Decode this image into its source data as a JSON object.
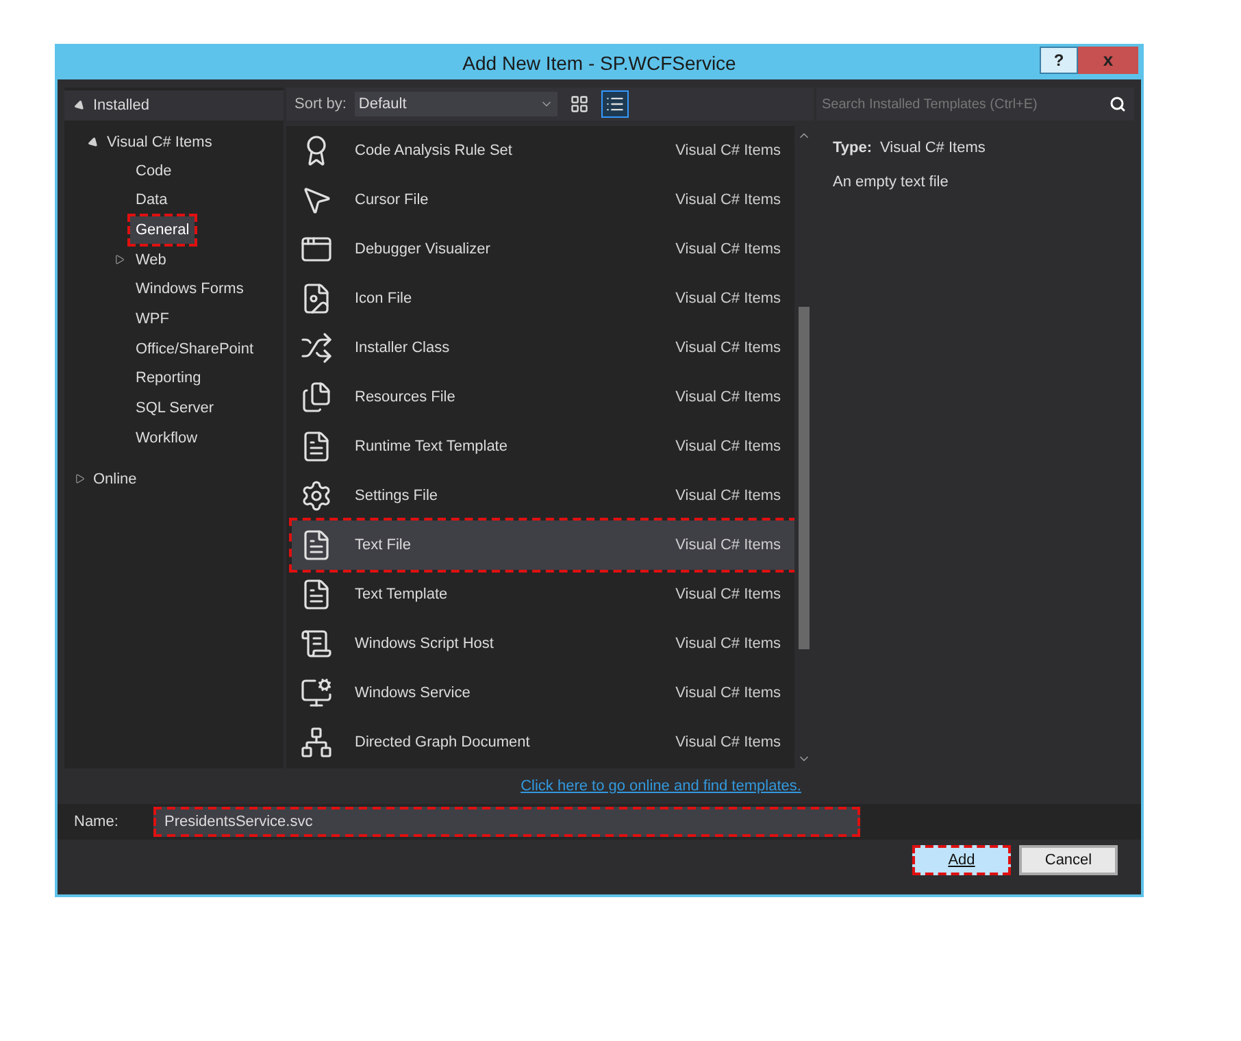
{
  "window": {
    "title": "Add New Item - SP.WCFService",
    "buttons": [
      "?",
      "x"
    ]
  },
  "tree": [
    {
      "label": "Installed",
      "expanded": true,
      "children": [
        {
          "label": "Visual C# Items",
          "expanded": true,
          "children": [
            {
              "label": "Code",
              "selected": false,
              "highlighted": false
            },
            {
              "label": "Data",
              "selected": false,
              "highlighted": false
            },
            {
              "label": "General",
              "selected": true,
              "highlighted": true
            },
            {
              "label": "Web",
              "selected": false,
              "highlighted": false,
              "expanded": false
            },
            {
              "label": "Windows Forms",
              "selected": false,
              "highlighted": false
            },
            {
              "label": "WPF",
              "selected": false,
              "highlighted": false
            },
            {
              "label": "Office/SharePoint",
              "selected": false,
              "highlighted": false
            },
            {
              "label": "Reporting",
              "selected": false,
              "highlighted": false
            },
            {
              "label": "SQL Server",
              "selected": false,
              "highlighted": false
            },
            {
              "label": "Workflow",
              "selected": false,
              "highlighted": false
            }
          ]
        }
      ]
    },
    {
      "label": "Online",
      "expanded": false
    }
  ],
  "toolbar": {
    "sort_label": "Sort by:",
    "sort_value": "Default",
    "view_modes": [
      {
        "kind": "grid",
        "selected": false
      },
      {
        "kind": "list",
        "selected": true
      }
    ]
  },
  "search": {
    "placeholder": "Search Installed Templates (Ctrl+E)"
  },
  "templates": [
    {
      "name": "Code Analysis Rule Set",
      "category": "Visual C# Items",
      "selected": false,
      "highlighted": false
    },
    {
      "name": "Cursor File",
      "category": "Visual C# Items",
      "selected": false,
      "highlighted": false
    },
    {
      "name": "Debugger Visualizer",
      "category": "Visual C# Items",
      "selected": false,
      "highlighted": false
    },
    {
      "name": "Icon File",
      "category": "Visual C# Items",
      "selected": false,
      "highlighted": false
    },
    {
      "name": "Installer Class",
      "category": "Visual C# Items",
      "selected": false,
      "highlighted": false
    },
    {
      "name": "Resources File",
      "category": "Visual C# Items",
      "selected": false,
      "highlighted": false
    },
    {
      "name": "Runtime Text Template",
      "category": "Visual C# Items",
      "selected": false,
      "highlighted": false
    },
    {
      "name": "Settings File",
      "category": "Visual C# Items",
      "selected": false,
      "highlighted": false
    },
    {
      "name": "Text File",
      "category": "Visual C# Items",
      "selected": true,
      "highlighted": true
    },
    {
      "name": "Text Template",
      "category": "Visual C# Items",
      "selected": false,
      "highlighted": false
    },
    {
      "name": "Windows Script Host",
      "category": "Visual C# Items",
      "selected": false,
      "highlighted": false
    },
    {
      "name": "Windows Service",
      "category": "Visual C# Items",
      "selected": false,
      "highlighted": false
    },
    {
      "name": "Directed Graph Document",
      "category": "Visual C# Items",
      "selected": false,
      "highlighted": false
    }
  ],
  "details": {
    "type_label": "Type:",
    "type_value": "Visual C# Items",
    "description": "An empty text file"
  },
  "online_link": "Click here to go online and find templates.",
  "name_field": {
    "label": "Name:",
    "value": "PresidentsService.svc",
    "highlighted": true
  },
  "buttons": [
    {
      "label": "Add",
      "kind": "primary",
      "highlighted": true
    },
    {
      "label": "Cancel",
      "kind": "secondary",
      "highlighted": false
    }
  ]
}
